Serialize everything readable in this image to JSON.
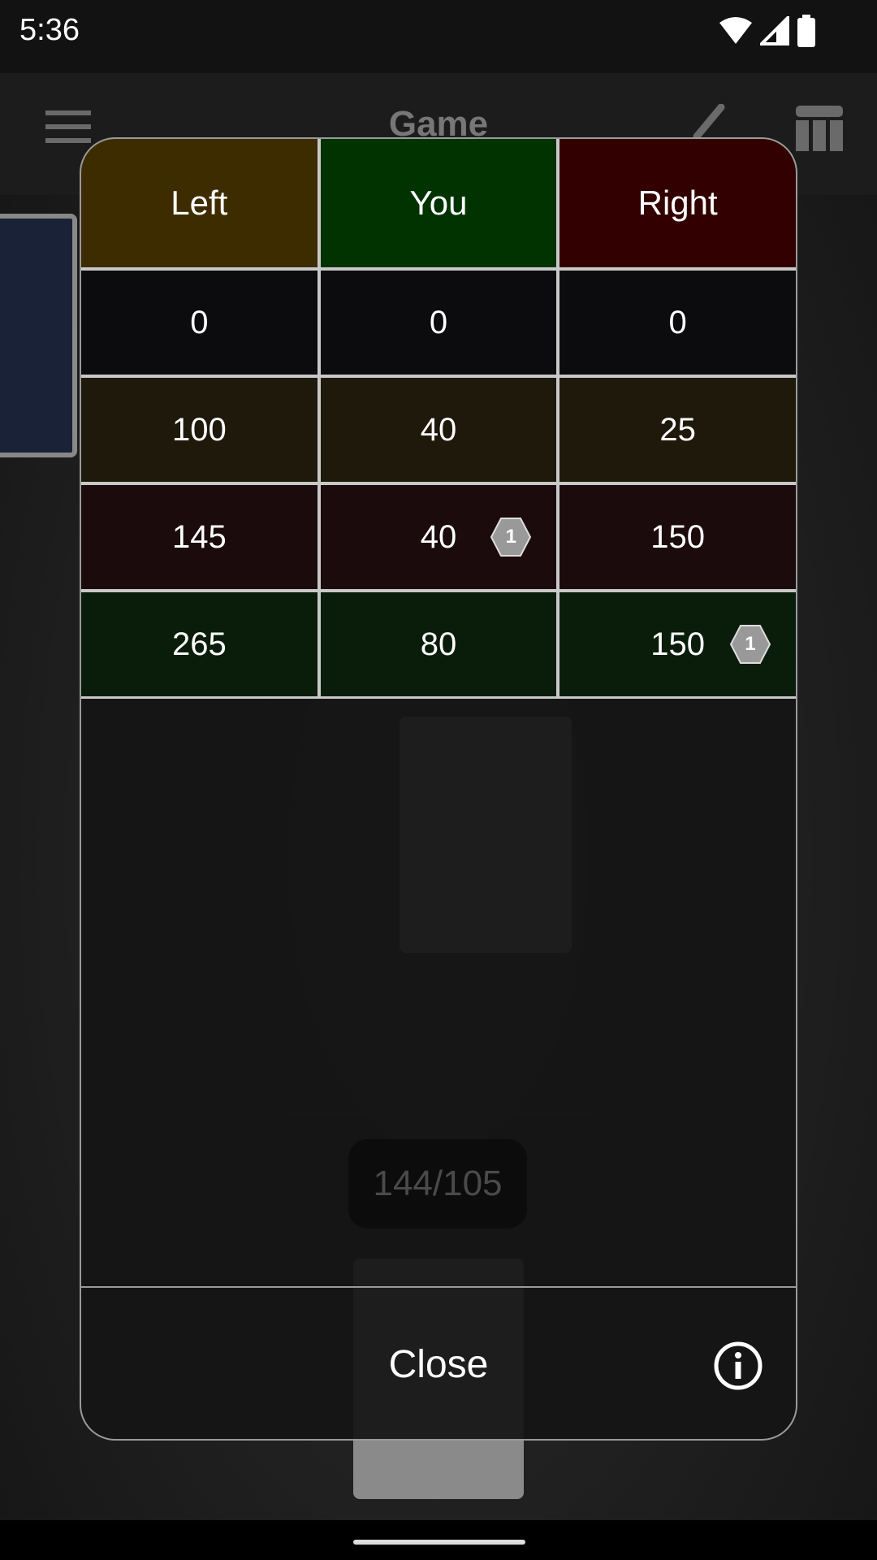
{
  "status_bar": {
    "time": "5:36",
    "icons": [
      "wifi-icon",
      "signal-icon",
      "battery-icon"
    ]
  },
  "toolbar": {
    "title": "Game",
    "icons": [
      "menu-icon",
      "brush-icon",
      "table-icon"
    ]
  },
  "background": {
    "counter": "144/105"
  },
  "score_table": {
    "headers": [
      {
        "label": "Left",
        "color": "#3d2c00"
      },
      {
        "label": "You",
        "color": "#003300"
      },
      {
        "label": "Right",
        "color": "#330000"
      }
    ],
    "rows": [
      {
        "color": "#0c0c0e",
        "cells": [
          {
            "value": "0"
          },
          {
            "value": "0"
          },
          {
            "value": "0"
          }
        ]
      },
      {
        "color": "#1e190b",
        "cells": [
          {
            "value": "100"
          },
          {
            "value": "40"
          },
          {
            "value": "25"
          }
        ]
      },
      {
        "color": "#1b0b0d",
        "cells": [
          {
            "value": "145"
          },
          {
            "value": "40",
            "badge": "1"
          },
          {
            "value": "150"
          }
        ]
      },
      {
        "color": "#0a1d0a",
        "cells": [
          {
            "value": "265"
          },
          {
            "value": "80"
          },
          {
            "value": "150",
            "badge": "1"
          }
        ]
      }
    ]
  },
  "footer": {
    "close_label": "Close",
    "info_icon": "info-icon"
  }
}
